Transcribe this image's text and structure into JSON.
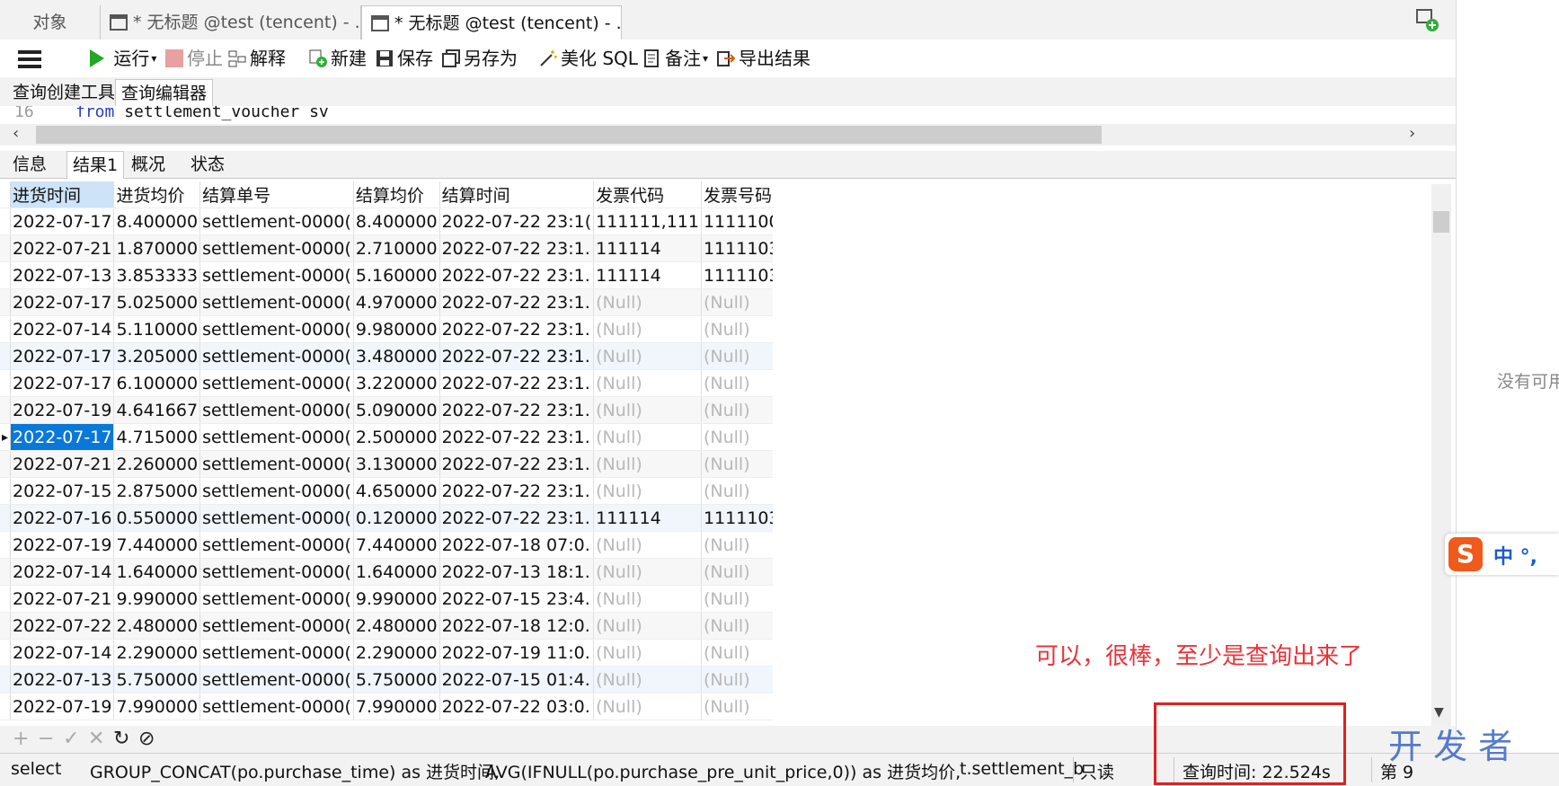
{
  "tabs": [
    {
      "label": "对象"
    },
    {
      "label": "* 无标题 @test (tencent) - ..."
    },
    {
      "label": "* 无标题 @test (tencent) - ..."
    }
  ],
  "toolbar": {
    "run": "运行",
    "stop": "停止",
    "explain": "解释",
    "new": "新建",
    "save": "保存",
    "save_as": "另存为",
    "beautify": "美化 SQL",
    "comment": "备注",
    "export": "导出结果"
  },
  "subtabs": [
    "查询创建工具",
    "查询编辑器"
  ],
  "editor": {
    "line_no": "16",
    "kw": "from",
    "rest": " settlement_voucher sv"
  },
  "result_tabs": [
    "信息",
    "结果1",
    "概况",
    "状态"
  ],
  "columns": [
    "进货时间",
    "进货均价",
    "结算单号",
    "结算均价",
    "结算时间",
    "发票代码",
    "发票号码"
  ],
  "rows": [
    [
      "2022-07-17",
      "8.400000",
      "settlement-0000(",
      "8.400000",
      "2022-07-22 23:1(",
      "111111,111",
      "1111100,11"
    ],
    [
      "2022-07-21",
      "1.870000",
      "settlement-0000(",
      "2.710000",
      "2022-07-22 23:1.",
      "111114",
      "1111103"
    ],
    [
      "2022-07-13",
      "3.853333",
      "settlement-0000(",
      "5.160000",
      "2022-07-22 23:1.",
      "111114",
      "1111103"
    ],
    [
      "2022-07-17",
      "5.025000",
      "settlement-0000(",
      "4.970000",
      "2022-07-22 23:1.",
      "(Null)",
      "(Null)"
    ],
    [
      "2022-07-14",
      "5.110000",
      "settlement-0000(",
      "9.980000",
      "2022-07-22 23:1.",
      "(Null)",
      "(Null)"
    ],
    [
      "2022-07-17",
      "3.205000",
      "settlement-0000(",
      "3.480000",
      "2022-07-22 23:1.",
      "(Null)",
      "(Null)"
    ],
    [
      "2022-07-17",
      "6.100000",
      "settlement-0000(",
      "3.220000",
      "2022-07-22 23:1.",
      "(Null)",
      "(Null)"
    ],
    [
      "2022-07-19",
      "4.641667",
      "settlement-0000(",
      "5.090000",
      "2022-07-22 23:1.",
      "(Null)",
      "(Null)"
    ],
    [
      "2022-07-17",
      "4.715000",
      "settlement-0000(",
      "2.500000",
      "2022-07-22 23:1.",
      "(Null)",
      "(Null)"
    ],
    [
      "2022-07-21",
      "2.260000",
      "settlement-0000(",
      "3.130000",
      "2022-07-22 23:1.",
      "(Null)",
      "(Null)"
    ],
    [
      "2022-07-15",
      "2.875000",
      "settlement-0000(",
      "4.650000",
      "2022-07-22 23:1.",
      "(Null)",
      "(Null)"
    ],
    [
      "2022-07-16",
      "0.550000",
      "settlement-0000(",
      "0.120000",
      "2022-07-22 23:1.",
      "111114",
      "1111103"
    ],
    [
      "2022-07-19",
      "7.440000",
      "settlement-0000(",
      "7.440000",
      "2022-07-18 07:0.",
      "(Null)",
      "(Null)"
    ],
    [
      "2022-07-14",
      "1.640000",
      "settlement-0000(",
      "1.640000",
      "2022-07-13 18:1.",
      "(Null)",
      "(Null)"
    ],
    [
      "2022-07-21",
      "9.990000",
      "settlement-0000(",
      "9.990000",
      "2022-07-15 23:4.",
      "(Null)",
      "(Null)"
    ],
    [
      "2022-07-22",
      "2.480000",
      "settlement-0000(",
      "2.480000",
      "2022-07-18 12:0.",
      "(Null)",
      "(Null)"
    ],
    [
      "2022-07-14",
      "2.290000",
      "settlement-0000(",
      "2.290000",
      "2022-07-19 11:0.",
      "(Null)",
      "(Null)"
    ],
    [
      "2022-07-13",
      "5.750000",
      "settlement-0000(",
      "5.750000",
      "2022-07-15 01:4.",
      "(Null)",
      "(Null)"
    ],
    [
      "2022-07-19",
      "7.990000",
      "settlement-0000(",
      "7.990000",
      "2022-07-22 03:0.",
      "(Null)",
      "(Null)"
    ]
  ],
  "status": {
    "sql": "select",
    "sql2": "GROUP_CONCAT(po.purchase_time) as 进货时间,",
    "sql3": "AVG(IFNULL(po.purchase_pre_unit_price,0)) as 进货均价,",
    "sql4": "t.settlement_b",
    "readonly": "只读",
    "query_time": "查询时间: 22.524s",
    "record": "第 9"
  },
  "annotation": "可以，很棒，至少是查询出来了",
  "right_panel_text": "没有可用",
  "ime": "中 °,",
  "watermark": "开 发 者"
}
